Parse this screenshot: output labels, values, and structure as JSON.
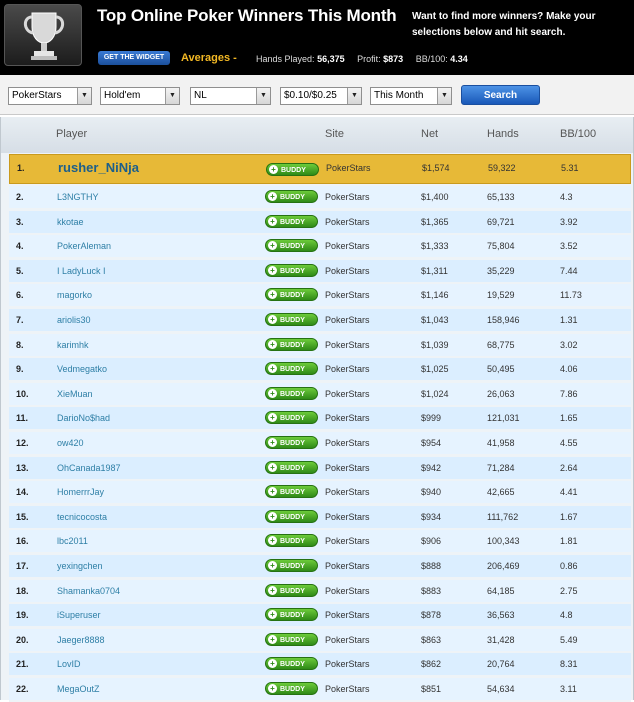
{
  "header": {
    "title": "Top Online Poker Winners This Month",
    "promo": "Want to find more winners? Make your selections below and hit search.",
    "widget_button": "GET THE WIDGET",
    "averages_label": "Averages -",
    "hands_label": "Hands Played:",
    "hands_value": "56,375",
    "profit_label": "Profit:",
    "profit_value": "$873",
    "bb_label": "BB/100:",
    "bb_value": "4.34"
  },
  "filters": {
    "site": "PokerStars",
    "game": "Hold'em",
    "limit": "NL",
    "stakes": "$0.10/$0.25",
    "period": "This Month",
    "search": "Search"
  },
  "table": {
    "headers": [
      "Player",
      "Site",
      "Net",
      "Hands",
      "BB/100"
    ],
    "buddy_label": "BUDDY",
    "rows": [
      {
        "rank": "1.",
        "player": "rusher_NiNja",
        "site": "PokerStars",
        "net": "$1,574",
        "hands": "59,322",
        "bb": "5.31"
      },
      {
        "rank": "2.",
        "player": "L3NGTHY",
        "site": "PokerStars",
        "net": "$1,400",
        "hands": "65,133",
        "bb": "4.3"
      },
      {
        "rank": "3.",
        "player": "kkotae",
        "site": "PokerStars",
        "net": "$1,365",
        "hands": "69,721",
        "bb": "3.92"
      },
      {
        "rank": "4.",
        "player": "PokerAleman",
        "site": "PokerStars",
        "net": "$1,333",
        "hands": "75,804",
        "bb": "3.52"
      },
      {
        "rank": "5.",
        "player": "I LadyLuck I",
        "site": "PokerStars",
        "net": "$1,311",
        "hands": "35,229",
        "bb": "7.44"
      },
      {
        "rank": "6.",
        "player": "magorko",
        "site": "PokerStars",
        "net": "$1,146",
        "hands": "19,529",
        "bb": "11.73"
      },
      {
        "rank": "7.",
        "player": "ariolis30",
        "site": "PokerStars",
        "net": "$1,043",
        "hands": "158,946",
        "bb": "1.31"
      },
      {
        "rank": "8.",
        "player": "karimhk",
        "site": "PokerStars",
        "net": "$1,039",
        "hands": "68,775",
        "bb": "3.02"
      },
      {
        "rank": "9.",
        "player": "Vedmegatko",
        "site": "PokerStars",
        "net": "$1,025",
        "hands": "50,495",
        "bb": "4.06"
      },
      {
        "rank": "10.",
        "player": "XieMuan",
        "site": "PokerStars",
        "net": "$1,024",
        "hands": "26,063",
        "bb": "7.86"
      },
      {
        "rank": "11.",
        "player": "DarioNo$had",
        "site": "PokerStars",
        "net": "$999",
        "hands": "121,031",
        "bb": "1.65"
      },
      {
        "rank": "12.",
        "player": "ow420",
        "site": "PokerStars",
        "net": "$954",
        "hands": "41,958",
        "bb": "4.55"
      },
      {
        "rank": "13.",
        "player": "OhCanada1987",
        "site": "PokerStars",
        "net": "$942",
        "hands": "71,284",
        "bb": "2.64"
      },
      {
        "rank": "14.",
        "player": "HomerrrJay",
        "site": "PokerStars",
        "net": "$940",
        "hands": "42,665",
        "bb": "4.41"
      },
      {
        "rank": "15.",
        "player": "tecnicocosta",
        "site": "PokerStars",
        "net": "$934",
        "hands": "111,762",
        "bb": "1.67"
      },
      {
        "rank": "16.",
        "player": "lbc2011",
        "site": "PokerStars",
        "net": "$906",
        "hands": "100,343",
        "bb": "1.81"
      },
      {
        "rank": "17.",
        "player": "yexingchen",
        "site": "PokerStars",
        "net": "$888",
        "hands": "206,469",
        "bb": "0.86"
      },
      {
        "rank": "18.",
        "player": "Shamanka0704",
        "site": "PokerStars",
        "net": "$883",
        "hands": "64,185",
        "bb": "2.75"
      },
      {
        "rank": "19.",
        "player": "iSuperuser",
        "site": "PokerStars",
        "net": "$878",
        "hands": "36,563",
        "bb": "4.8"
      },
      {
        "rank": "20.",
        "player": "Jaeger8888",
        "site": "PokerStars",
        "net": "$863",
        "hands": "31,428",
        "bb": "5.49"
      },
      {
        "rank": "21.",
        "player": "LovID",
        "site": "PokerStars",
        "net": "$862",
        "hands": "20,764",
        "bb": "8.31"
      },
      {
        "rank": "22.",
        "player": "MegaOutZ",
        "site": "PokerStars",
        "net": "$851",
        "hands": "54,634",
        "bb": "3.11"
      }
    ]
  }
}
